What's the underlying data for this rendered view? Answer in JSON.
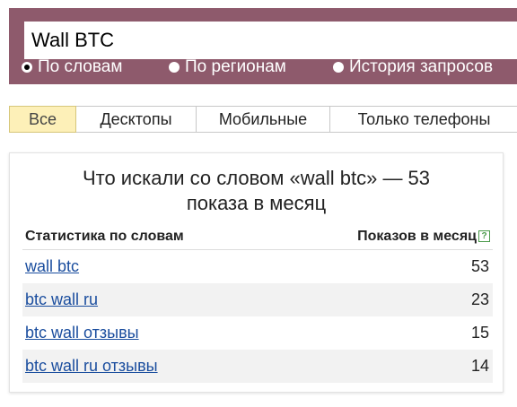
{
  "search": {
    "value": "Wall BTC",
    "modes": [
      {
        "label": "По словам",
        "checked": true
      },
      {
        "label": "По регионам",
        "checked": false
      },
      {
        "label": "История запросов",
        "checked": false
      }
    ]
  },
  "tabs": [
    {
      "label": "Все",
      "active": true
    },
    {
      "label": "Десктопы",
      "active": false
    },
    {
      "label": "Мобильные",
      "active": false
    },
    {
      "label": "Только телефоны",
      "active": false
    }
  ],
  "stats": {
    "title_line1": "Что искали со словом «wall btc» — 53",
    "title_line2": "показа в месяц",
    "col_words": "Статистика по словам",
    "col_count": "Показов в месяц",
    "help_glyph": "?",
    "rows": [
      {
        "phrase": "wall btc",
        "count": "53"
      },
      {
        "phrase": "btc wall ru",
        "count": "23"
      },
      {
        "phrase": "btc wall отзывы",
        "count": "15"
      },
      {
        "phrase": "btc wall ru отзывы",
        "count": "14"
      }
    ]
  },
  "colors": {
    "header_bg": "#8e5a6c",
    "active_tab_bg": "#fdf0b8",
    "link": "#1a4d9e",
    "row_shade": "#f2f2f2"
  }
}
